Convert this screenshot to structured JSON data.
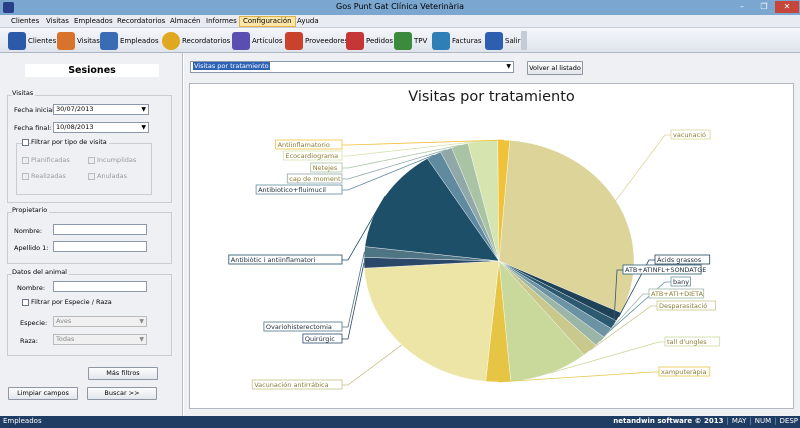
{
  "window": {
    "title": "Gos Punt Gat Clínica Veterinària",
    "minimize": "–",
    "maximize": "❐",
    "close": "✕"
  },
  "menu": [
    "Clientes",
    "Visitas",
    "Empleados",
    "Recordatorios",
    "Almacén",
    "Informes",
    "Configuración",
    "Ayuda"
  ],
  "toolbar": [
    {
      "label": "Clientes",
      "icon": "clients-icon",
      "color": "#2b5aa8"
    },
    {
      "label": "Visitas",
      "icon": "visits-icon",
      "color": "#d9732b"
    },
    {
      "label": "Empleados",
      "icon": "employees-icon",
      "color": "#3a6bb5"
    },
    {
      "label": "Recordatorios",
      "icon": "clock-icon",
      "color": "#e0a820"
    },
    {
      "label": "Artículos",
      "icon": "articles-icon",
      "color": "#5a4fb0"
    },
    {
      "label": "Proveedores",
      "icon": "suppliers-icon",
      "color": "#c8422c"
    },
    {
      "label": "Pedidos",
      "icon": "orders-icon",
      "color": "#c73636"
    },
    {
      "label": "TPV",
      "icon": "tpv-icon",
      "color": "#3c8a3c"
    },
    {
      "label": "Facturas",
      "icon": "invoices-icon",
      "color": "#2d7fb5"
    },
    {
      "label": "Salir",
      "icon": "exit-icon",
      "color": "#2d5fb0"
    }
  ],
  "sidebar": {
    "title": "Sesiones",
    "visitas": {
      "group": "Visitas",
      "fecha_inicial_label": "Fecha inicial:",
      "fecha_inicial": "30/07/2013",
      "fecha_final_label": "Fecha final:",
      "fecha_final": "10/08/2013",
      "filter_label": "Filtrar por tipo de visita",
      "types": [
        "Planificadas",
        "Incumplidas",
        "Realizadas",
        "Anuladas"
      ]
    },
    "propietario": {
      "group": "Propietario",
      "nombre_label": "Nombre:",
      "apellido_label": "Apellido 1:"
    },
    "animal": {
      "group": "Datos del animal",
      "nombre_label": "Nombre:",
      "filter_label": "Filtrar por Especie / Raza",
      "especie_label": "Especie:",
      "especie": "Aves",
      "raza_label": "Raza:",
      "raza": "Todas"
    },
    "mas_filtros": "Más filtros",
    "limpiar": "Limpiar campos",
    "buscar": "Buscar  >>"
  },
  "main": {
    "report_select": "Visitas por tratamiento",
    "back_button": "Volver al listado",
    "chart_arrow": "▼"
  },
  "chart_data": {
    "type": "pie",
    "title": "Visitas por tratamiento",
    "slices": [
      {
        "label": "vacunació",
        "value": 26.0,
        "color": "#ddd49a"
      },
      {
        "label": "Àcids grassos",
        "value": 1.0,
        "color": "#1f4259"
      },
      {
        "label": "ATB+ATINFL+SONDATGE",
        "value": 1.0,
        "color": "#2c5a70"
      },
      {
        "label": "bany",
        "value": 1.2,
        "color": "#6b93a4"
      },
      {
        "label": "ATB+ATI+DIETA",
        "value": 1.2,
        "color": "#9bb6a6"
      },
      {
        "label": "Desparasitació",
        "value": 1.6,
        "color": "#c9c98e"
      },
      {
        "label": "tall d'ungles",
        "value": 8.0,
        "color": "#c9d99c"
      },
      {
        "label": "xamputeràpia",
        "value": 2.5,
        "color": "#e7c544"
      },
      {
        "label": "Vacunación antirrábica",
        "value": 19.0,
        "color": "#ede5a6"
      },
      {
        "label": "Quirúrgic",
        "value": 1.2,
        "color": "#2a4868"
      },
      {
        "label": "Ovariohisterectomia",
        "value": 1.2,
        "color": "#4f7484"
      },
      {
        "label": "Antibiòtic i antiinflamatori",
        "value": 12.0,
        "color": "#1e4f68"
      },
      {
        "label": "Antibiotico+fluimucil",
        "value": 1.5,
        "color": "#5f8aa0"
      },
      {
        "label": "cap de moment",
        "value": 1.2,
        "color": "#90a8a8"
      },
      {
        "label": "Netejes",
        "value": 1.7,
        "color": "#a9c4a4"
      },
      {
        "label": "Ecocardiograma",
        "value": 3.0,
        "color": "#d6e4b0"
      },
      {
        "label": "Antiinflamatorio",
        "value": 1.2,
        "color": "#f0c23a"
      }
    ]
  },
  "status": {
    "left": "Empleados",
    "brand": "netandwin software © 2013",
    "caps": "MAY",
    "num": "NUM",
    "scroll": "DESP"
  }
}
